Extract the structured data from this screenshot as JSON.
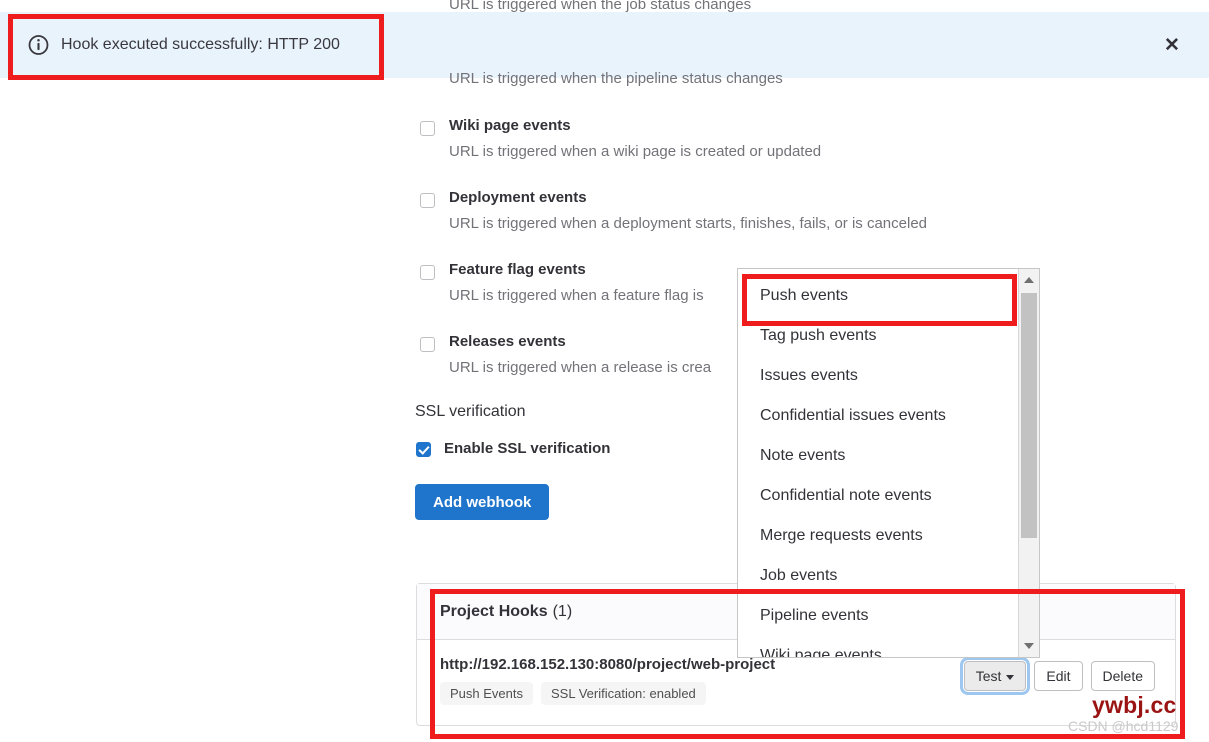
{
  "alert": {
    "message": "Hook executed successfully: HTTP 200",
    "icon": "info-circle-icon",
    "close_label": "✕",
    "background_color": "#e9f3fc"
  },
  "clipped_top_description": "URL is triggered when the job status changes",
  "pipeline_description": "URL is triggered when the pipeline status changes",
  "trigger_events": [
    {
      "label": "Wiki page events",
      "description": "URL is triggered when a wiki page is created or updated",
      "checked": false
    },
    {
      "label": "Deployment events",
      "description": "URL is triggered when a deployment starts, finishes, fails, or is canceled",
      "checked": false
    },
    {
      "label": "Feature flag events",
      "description": "URL is triggered when a feature flag is",
      "checked": false
    },
    {
      "label": "Releases events",
      "description": "URL is triggered when a release is crea",
      "checked": false
    }
  ],
  "ssl": {
    "section_title": "SSL verification",
    "checkbox_label": "Enable SSL verification",
    "checked": true
  },
  "add_webhook_button": {
    "label": "Add webhook",
    "color": "#1f75cb"
  },
  "dropdown": {
    "items": [
      "Push events",
      "Tag push events",
      "Issues events",
      "Confidential issues events",
      "Note events",
      "Confidential note events",
      "Merge requests events",
      "Job events",
      "Pipeline events",
      "Wiki page events"
    ],
    "highlighted_item": "Push events",
    "scrollbar_up_icon": "triangle-up-icon",
    "scrollbar_down_icon": "triangle-down-icon"
  },
  "project_hooks": {
    "title": "Project Hooks",
    "count": "(1)",
    "hook": {
      "url": "http://192.168.152.130:8080/project/web-project",
      "badges": [
        "Push Events",
        "SSL Verification: enabled"
      ],
      "actions": {
        "test": "Test",
        "test_caret_icon": "chevron-down-icon",
        "edit": "Edit",
        "delete": "Delete"
      }
    }
  },
  "watermark": {
    "primary": "ywbj.cc",
    "secondary": "CSDN @hcd1129",
    "primary_color": "#9b1414"
  },
  "annotations": {
    "highlight_color": "#ee1c1c",
    "boxes": [
      "alert-banner",
      "push-events-item",
      "project-hooks-card"
    ]
  }
}
